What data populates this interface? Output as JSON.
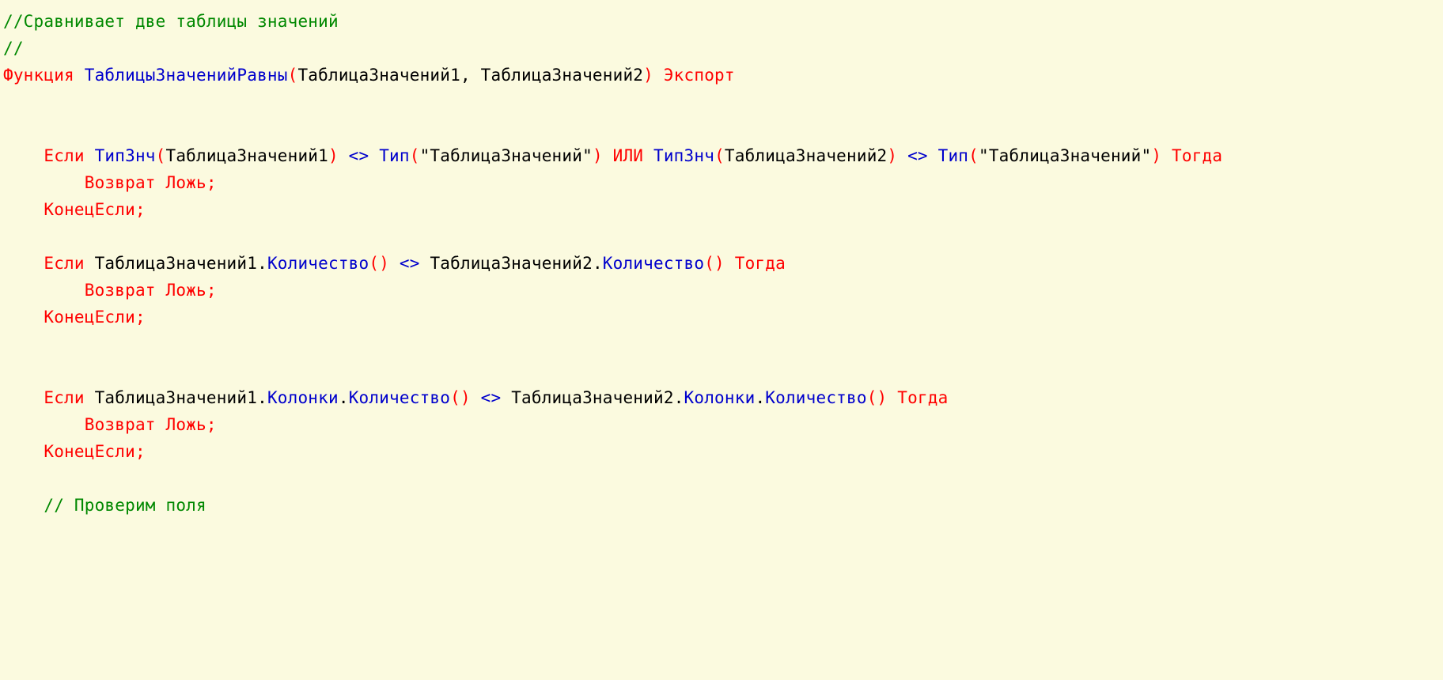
{
  "code": {
    "line1_comment": "//Сравнивает две таблицы значений",
    "line2_comment": "//",
    "func_kw": "Функция",
    "func_name": "ТаблицыЗначенийРавны",
    "func_open": "(",
    "func_args": "ТаблицаЗначений1, ТаблицаЗначений2",
    "func_close": ")",
    "export_kw": "Экспорт",
    "if1_if": "Если",
    "if1_typznch1": "ТипЗнч",
    "if1_open1": "(",
    "if1_arg1": "ТаблицаЗначений1",
    "if1_close1": ")",
    "if1_neq1": " <> ",
    "if1_typ1": "Тип",
    "if1_open2": "(",
    "if1_str1": "\"ТаблицаЗначений\"",
    "if1_close2": ")",
    "if1_or": " ИЛИ ",
    "if1_typznch2": "ТипЗнч",
    "if1_open3": "(",
    "if1_arg2": "ТаблицаЗначений2",
    "if1_close3": ")",
    "if1_neq2": " <> ",
    "if1_typ2": "Тип",
    "if1_open4": "(",
    "if1_str2": "\"ТаблицаЗначений\"",
    "if1_close4": ")",
    "if1_then": "Тогда",
    "return_false": "Возврат Ложь;",
    "endif": "КонецЕсли;",
    "if2_if": "Если",
    "if2_obj1": "ТаблицаЗначений1",
    "if2_dot1": ".",
    "if2_count1": "Количество",
    "if2_par1": "()",
    "if2_neq": " <> ",
    "if2_obj2": "ТаблицаЗначений2",
    "if2_dot2": ".",
    "if2_count2": "Количество",
    "if2_par2": "()",
    "if2_then": "Тогда",
    "if3_if": "Если",
    "if3_obj1": "ТаблицаЗначений1",
    "if3_dot1": ".",
    "if3_cols1": "Колонки",
    "if3_dot2": ".",
    "if3_count1": "Количество",
    "if3_par1": "()",
    "if3_neq": " <> ",
    "if3_obj2": "ТаблицаЗначений2",
    "if3_dot3": ".",
    "if3_cols2": "Колонки",
    "if3_dot4": ".",
    "if3_count2": "Количество",
    "if3_par2": "()",
    "if3_then": "Тогда",
    "check_fields_comment": "// Проверим поля",
    "indent1": "    ",
    "indent2": "        ",
    "space": " "
  }
}
